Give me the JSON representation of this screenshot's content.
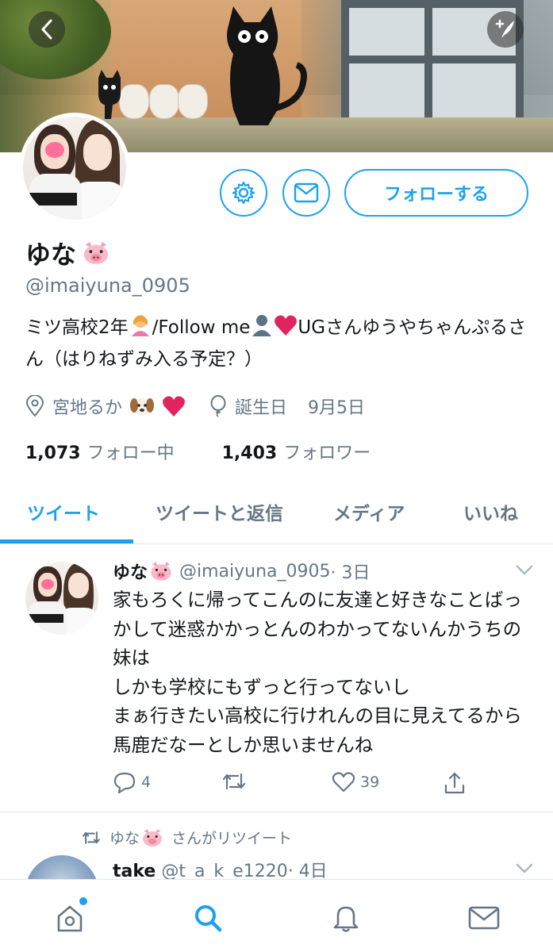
{
  "header": {
    "back_icon": "chevron-left-icon",
    "compose_icon": "compose-tweet-icon"
  },
  "profile": {
    "name": "ゆな",
    "name_emoji": "pig-face-emoji",
    "handle": "@imaiyuna_0905",
    "follow_label": "フォローする",
    "settings_icon": "gear-icon",
    "message_icon": "envelope-icon",
    "bio_part1": "ミツ高校2年",
    "bio_part2": "/Follow me",
    "bio_part3": "UGさんゆうやちゃんぷるさん（はりねずみ入る予定？）",
    "location": "宮地るか",
    "birthday_label": "誕生日",
    "birthday": "9月5日",
    "following_count": "1,073",
    "following_label": "フォロー中",
    "followers_count": "1,403",
    "followers_label": "フォロワー"
  },
  "tabs": [
    {
      "label": "ツイート",
      "active": true
    },
    {
      "label": "ツイートと返信",
      "active": false
    },
    {
      "label": "メディア",
      "active": false
    },
    {
      "label": "いいね",
      "active": false
    }
  ],
  "tweet": {
    "name": "ゆな",
    "handle": "@imaiyuna_0905",
    "time": "· 3日",
    "body": "家もろくに帰ってこんのに友達と好きなことばっかして迷惑かかっとんのわかってないんかうちの妹は\nしかも学校にもずっと行ってないし\nまぁ行きたい高校に行けれんの目に見えてるから馬鹿だなーとしか思いませんね",
    "replies": "4",
    "retweets": "",
    "likes": "39"
  },
  "retweet": {
    "label": "さんがリツイート",
    "retweeter": "ゆな",
    "name": "take",
    "handle": "@t_a_k_e1220",
    "time": "· 4日"
  },
  "bottom_nav": [
    {
      "icon": "home-icon",
      "active": false
    },
    {
      "icon": "search-icon",
      "active": true
    },
    {
      "icon": "bell-icon",
      "active": false
    },
    {
      "icon": "mail-icon",
      "active": false
    }
  ],
  "colors": {
    "accent": "#1da1f2",
    "text": "#14171a",
    "secondary": "#657786",
    "heart": "#e0245e"
  }
}
